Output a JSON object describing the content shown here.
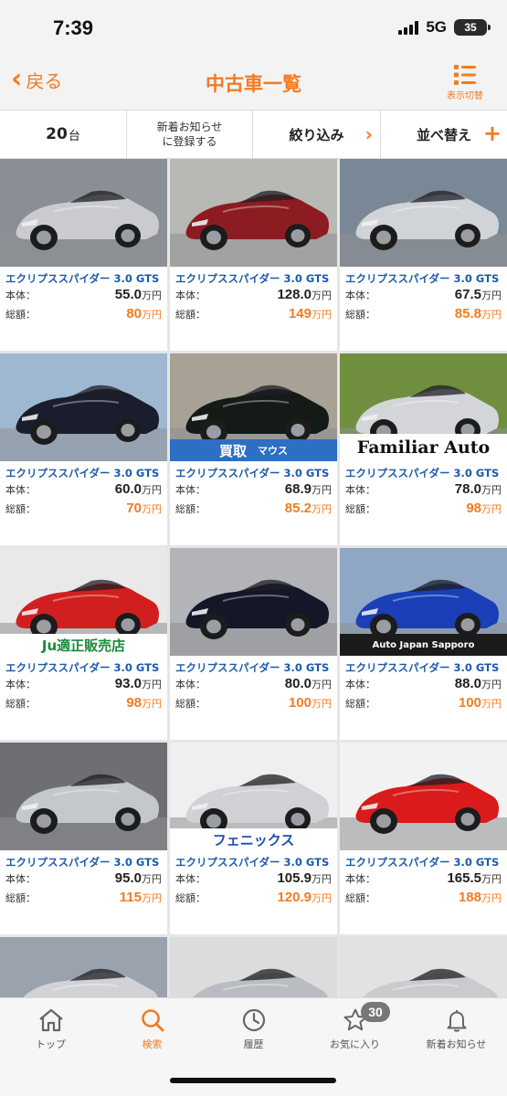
{
  "status_bar": {
    "time": "7:39",
    "network": "5G",
    "battery": "35"
  },
  "header": {
    "back_label": "戻る",
    "title": "中古車一覧",
    "view_toggle_label": "表示切替"
  },
  "filter_bar": {
    "count_value": "20",
    "count_unit": "台",
    "notify_line1": "新着お知らせ",
    "notify_line2": "に登録する",
    "filter_label": "絞り込み",
    "sort_label": "並べ替え"
  },
  "labels": {
    "base_price": "本体：",
    "total_price": "総額：",
    "unit": "万円"
  },
  "colors": {
    "accent": "#f47b20",
    "link": "#1e5aa8"
  },
  "listings": [
    {
      "name": "エクリプススパイダー 3.0 GTS",
      "base": "55.0",
      "total": "80",
      "car_color": "#c9cbcf",
      "bg": "#8a8f96"
    },
    {
      "name": "エクリプススパイダー 3.0 GTS",
      "base": "128.0",
      "total": "149",
      "car_color": "#8c1c22",
      "bg": "#b8b8b4"
    },
    {
      "name": "エクリプススパイダー 3.0 GTS",
      "base": "67.5",
      "total": "85.8",
      "car_color": "#d0d3d7",
      "bg": "#7a8796"
    },
    {
      "name": "エクリプススパイダー 3.0 GTS",
      "base": "60.0",
      "total": "70",
      "car_color": "#1a1d2c",
      "bg": "#9fb8d1"
    },
    {
      "name": "エクリプススパイダー 3.0 GTS",
      "base": "68.9",
      "total": "85.2",
      "car_color": "#141a16",
      "bg": "#a7a196",
      "banner": {
        "text1": "買取",
        "text2": "マウス",
        "bg": "#2d6fc4",
        "fg": "#ffffff"
      }
    },
    {
      "name": "エクリプススパイダー 3.0 GTS",
      "base": "78.0",
      "total": "98",
      "car_color": "#d3d5d8",
      "bg": "#6f8f3f",
      "banner": {
        "text1": "Familiar Auto",
        "text2": "",
        "bg": "#ffffff",
        "fg": "#111111"
      }
    },
    {
      "name": "エクリプススパイダー 3.0 GTS",
      "base": "93.0",
      "total": "98",
      "car_color": "#d11f1f",
      "bg": "#e9e9e9",
      "banner": {
        "text1": "Ju適正販売店",
        "text2": "",
        "bg": "#ffffff",
        "fg": "#1a8a3a"
      }
    },
    {
      "name": "エクリプススパイダー 3.0 GTS",
      "base": "80.0",
      "total": "100",
      "car_color": "#141728",
      "bg": "#b2b4b8"
    },
    {
      "name": "エクリプススパイダー 3.0 GTS",
      "base": "88.0",
      "total": "100",
      "car_color": "#1a3fb6",
      "bg": "#8fa7c4",
      "banner": {
        "text1": "Auto Japan Sapporo",
        "text2": "",
        "bg": "#1b1b1b",
        "fg": "#ffffff"
      }
    },
    {
      "name": "エクリプススパイダー 3.0 GTS",
      "base": "95.0",
      "total": "115",
      "car_color": "#c4c7cb",
      "bg": "#6d6f72"
    },
    {
      "name": "エクリプススパイダー 3.0 GTS",
      "base": "105.9",
      "total": "120.9",
      "car_color": "#cfd1d4",
      "bg": "#efefef",
      "banner": {
        "text1": "フェニックス",
        "text2": "",
        "bg": "#ffffff",
        "fg": "#1e4fb0"
      }
    },
    {
      "name": "エクリプススパイダー 3.0 GTS",
      "base": "165.5",
      "total": "188",
      "car_color": "#d91b1b",
      "bg": "#f2f2f2"
    },
    {
      "name": "",
      "base": "",
      "total": "",
      "car_color": "#d0d2d5",
      "bg": "#9aa3ad"
    },
    {
      "name": "",
      "base": "",
      "total": "",
      "car_color": "#b9bcc0",
      "bg": "#dcdcdc"
    },
    {
      "name": "",
      "base": "",
      "total": "",
      "car_color": "#c9cbce",
      "bg": "#e2e2e2"
    }
  ],
  "tabs": [
    {
      "key": "top",
      "label": "トップ",
      "icon": "home-icon"
    },
    {
      "key": "search",
      "label": "検索",
      "icon": "search-icon",
      "active": true
    },
    {
      "key": "history",
      "label": "履歴",
      "icon": "clock-icon"
    },
    {
      "key": "favorites",
      "label": "お気に入り",
      "icon": "star-icon",
      "badge": "30"
    },
    {
      "key": "news",
      "label": "新着お知らせ",
      "icon": "bell-icon"
    }
  ]
}
